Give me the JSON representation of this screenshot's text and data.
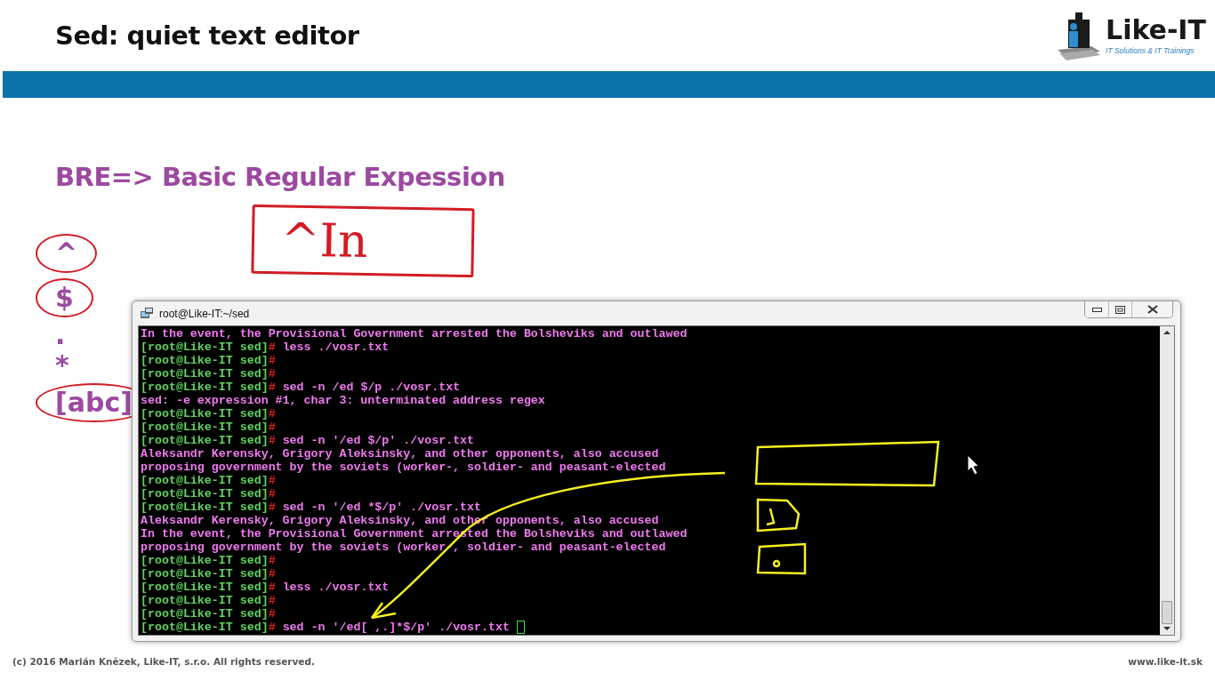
{
  "slide": {
    "title": "Sed: quiet text editor",
    "logo": {
      "name": "Like-IT",
      "tagline": "IT Solutions & IT Trainings"
    },
    "heading": "BRE=> Basic Regular Expession",
    "symbols": [
      {
        "text": "^",
        "circled": true
      },
      {
        "text": "$",
        "circled": true
      },
      {
        "text": ".",
        "circled": false
      },
      {
        "text": "*",
        "circled": false
      },
      {
        "text": "[abc]",
        "circled": true
      }
    ],
    "handwriting": "^In",
    "footer": {
      "copyright": "(c) 2016 Marián Knězek, Like-IT, s.r.o. All rights reserved.",
      "website": "www.like-it.sk"
    }
  },
  "terminal": {
    "title": "root@Like-IT:~/sed",
    "lines": [
      {
        "kind": "output",
        "text": "In the event, the Provisional Government arrested the Bolsheviks and outlawed"
      },
      {
        "kind": "prompt",
        "prompt": "[root@Like-IT sed]",
        "mark": "#",
        "command": "less ./vosr.txt",
        "cursor": false
      },
      {
        "kind": "prompt",
        "prompt": "[root@Like-IT sed]",
        "mark": "#",
        "cursor": false
      },
      {
        "kind": "prompt",
        "prompt": "[root@Like-IT sed]",
        "mark": "#",
        "cursor": false
      },
      {
        "kind": "prompt",
        "prompt": "[root@Like-IT sed]",
        "mark": "#",
        "command": "sed -n /ed $/p ./vosr.txt",
        "cursor": false
      },
      {
        "kind": "output",
        "text": "sed: -e expression #1, char 3: unterminated address regex"
      },
      {
        "kind": "prompt",
        "prompt": "[root@Like-IT sed]",
        "mark": "#",
        "cursor": false
      },
      {
        "kind": "prompt",
        "prompt": "[root@Like-IT sed]",
        "mark": "#",
        "cursor": false
      },
      {
        "kind": "prompt",
        "prompt": "[root@Like-IT sed]",
        "mark": "#",
        "command": "sed -n '/ed $/p' ./vosr.txt",
        "cursor": false
      },
      {
        "kind": "output",
        "text": "Aleksandr Kerensky, Grigory Aleksinsky, and other opponents, also accused"
      },
      {
        "kind": "output",
        "text": "proposing government by the soviets (worker-, soldier- and peasant-elected"
      },
      {
        "kind": "prompt",
        "prompt": "[root@Like-IT sed]",
        "mark": "#",
        "cursor": false
      },
      {
        "kind": "prompt",
        "prompt": "[root@Like-IT sed]",
        "mark": "#",
        "cursor": false
      },
      {
        "kind": "prompt",
        "prompt": "[root@Like-IT sed]",
        "mark": "#",
        "command": "sed -n '/ed *$/p' ./vosr.txt",
        "cursor": false
      },
      {
        "kind": "output",
        "text": "Aleksandr Kerensky, Grigory Aleksinsky, and other opponents, also accused"
      },
      {
        "kind": "output",
        "text": "In the event, the Provisional Government arrested the Bolsheviks and outlawed"
      },
      {
        "kind": "output",
        "text": "proposing government by the soviets (worker-, soldier- and peasant-elected"
      },
      {
        "kind": "prompt",
        "prompt": "[root@Like-IT sed]",
        "mark": "#",
        "cursor": false
      },
      {
        "kind": "prompt",
        "prompt": "[root@Like-IT sed]",
        "mark": "#",
        "cursor": false
      },
      {
        "kind": "prompt",
        "prompt": "[root@Like-IT sed]",
        "mark": "#",
        "command": "less ./vosr.txt",
        "cursor": false
      },
      {
        "kind": "prompt",
        "prompt": "[root@Like-IT sed]",
        "mark": "#",
        "cursor": false
      },
      {
        "kind": "prompt",
        "prompt": "[root@Like-IT sed]",
        "mark": "#",
        "cursor": false
      },
      {
        "kind": "prompt",
        "prompt": "[root@Like-IT sed]",
        "mark": "#",
        "command": "sed -n '/ed[ ,.]*$/p' ./vosr.txt",
        "cursor": true
      }
    ]
  }
}
